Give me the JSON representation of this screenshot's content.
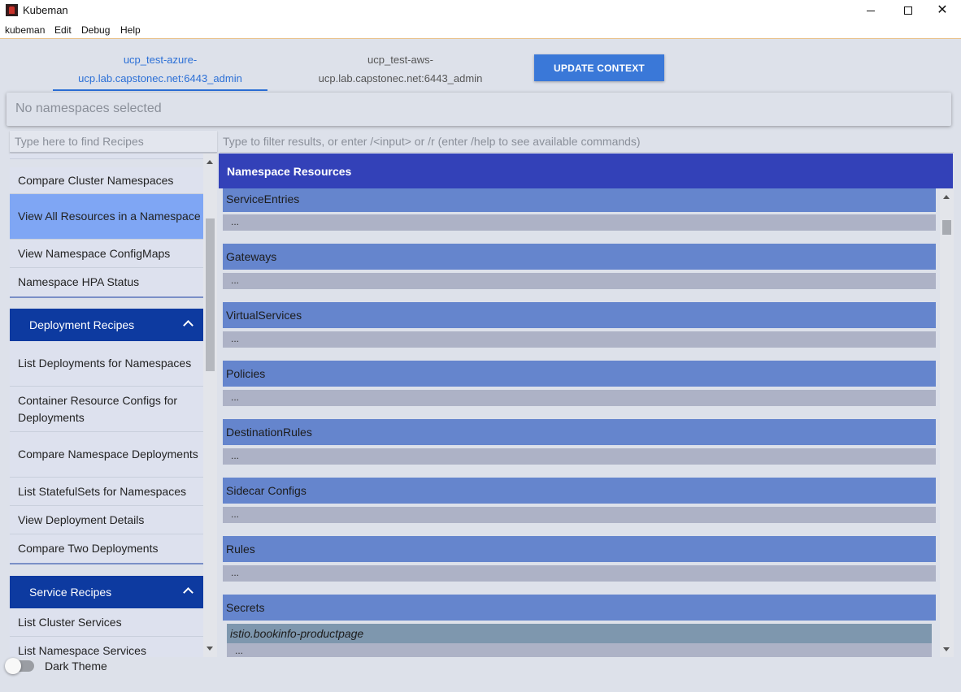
{
  "window": {
    "title": "Kubeman",
    "min_symbol": "",
    "max_symbol": "",
    "close_symbol": "✕"
  },
  "menu": [
    "kubeman",
    "Edit",
    "Debug",
    "Help"
  ],
  "contexts": [
    {
      "line1": "ucp_test-azure-",
      "line2": "ucp.lab.capstonec.net:6443_admin",
      "active": true
    },
    {
      "line1": "ucp_test-aws-",
      "line2": "ucp.lab.capstonec.net:6443_admin",
      "active": false
    }
  ],
  "update_button": "UPDATE CONTEXT",
  "namespace_bar": "No namespaces selected",
  "recipe_search": {
    "placeholder": "Type here to find Recipes"
  },
  "filter": {
    "placeholder": "Type to filter results, or enter /<input> or /r (enter /help to see available commands)"
  },
  "sidebar": {
    "items_top": [
      {
        "label": "Compare Cluster Namespaces"
      },
      {
        "label": "View All Resources in a Namespace",
        "selected": true
      },
      {
        "label": "View Namespace ConfigMaps"
      },
      {
        "label": "Namespace HPA Status"
      }
    ],
    "deployment_header": "Deployment Recipes",
    "deployment_items": [
      {
        "label": "List Deployments for Namespaces"
      },
      {
        "label": "Container Resource Configs for Deployments"
      },
      {
        "label": "Compare Namespace Deployments"
      },
      {
        "label": "List StatefulSets for Namespaces"
      },
      {
        "label": "View Deployment Details"
      },
      {
        "label": "Compare Two Deployments"
      }
    ],
    "service_header": "Service Recipes",
    "service_items": [
      {
        "label": "List Cluster Services"
      },
      {
        "label": "List Namespace Services"
      }
    ]
  },
  "main": {
    "header": "Namespace Resources",
    "sections": [
      {
        "title": "ServiceEntries",
        "content": "..."
      },
      {
        "title": "Gateways",
        "content": "..."
      },
      {
        "title": "VirtualServices",
        "content": "..."
      },
      {
        "title": "Policies",
        "content": "..."
      },
      {
        "title": "DestinationRules",
        "content": "..."
      },
      {
        "title": "Sidecar Configs",
        "content": "..."
      },
      {
        "title": "Rules",
        "content": "..."
      },
      {
        "title": "Secrets",
        "subtitle": "istio.bookinfo-productpage",
        "content": "..."
      }
    ]
  },
  "theme_toggle": {
    "label": "Dark Theme",
    "on": false
  },
  "colors": {
    "accent": "#3a78d8",
    "header_bar": "#3341b8",
    "sidebar_header": "#0d3aa0",
    "selected_item": "#7fa6f4",
    "section_title": "#6585cd"
  }
}
